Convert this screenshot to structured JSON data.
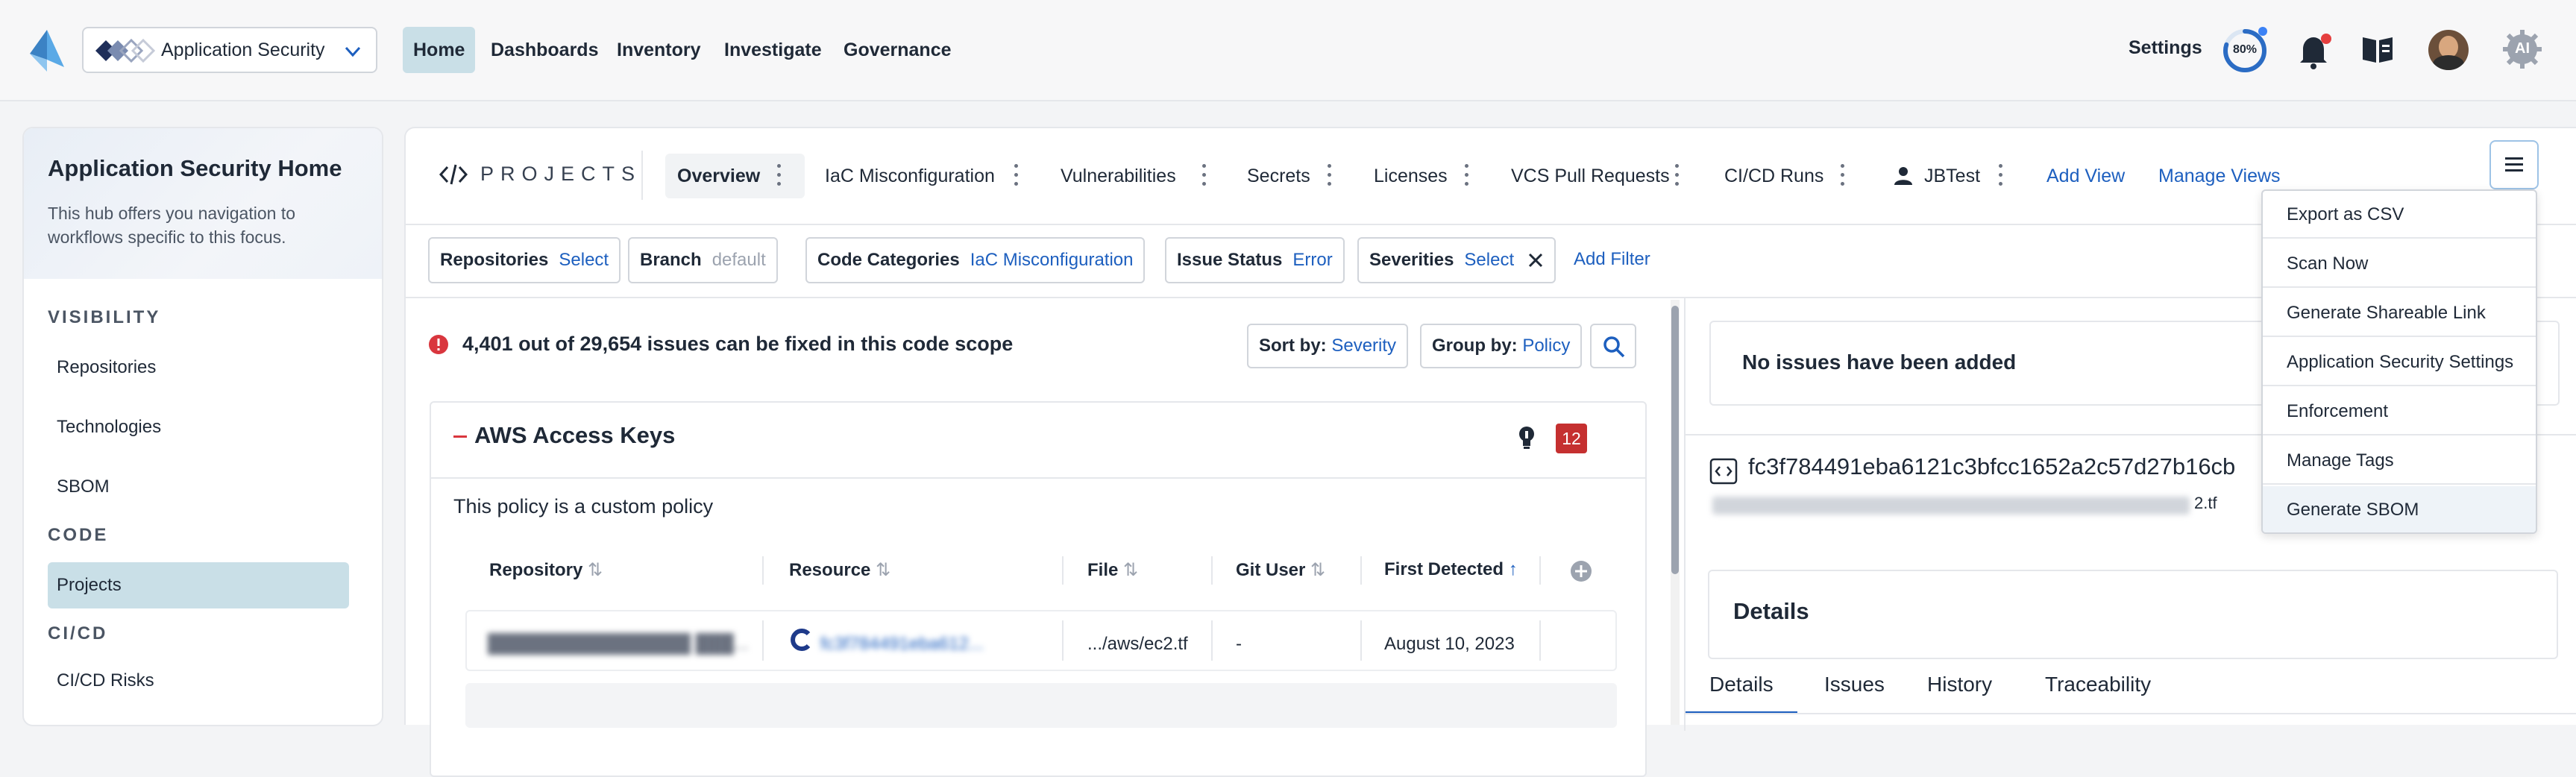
{
  "topbar": {
    "focus_label": "Application Security",
    "nav": [
      "Home",
      "Dashboards",
      "Inventory",
      "Investigate",
      "Governance"
    ],
    "settings_label": "Settings",
    "progress_label": "80%",
    "progress_value": 0.8,
    "ai_label": "AI",
    "accent_color": "#c9dfe7"
  },
  "sidebar": {
    "title": "Application Security Home",
    "subtitle": "This hub offers you navigation to workflows specific to this focus.",
    "sections": {
      "visibility": "VISIBILITY",
      "code": "CODE",
      "cicd": "CI/CD"
    },
    "items": {
      "repositories": "Repositories",
      "technologies": "Technologies",
      "sbom": "SBOM",
      "projects": "Projects",
      "cicd_risks": "CI/CD Risks"
    }
  },
  "main": {
    "projects_label": "PROJECTS",
    "tabs": [
      "Overview",
      "IaC Misconfiguration",
      "Vulnerabilities",
      "Secrets",
      "Licenses",
      "VCS Pull Requests",
      "CI/CD Runs",
      "JBTest"
    ],
    "add_view": "Add View",
    "manage_views": "Manage Views"
  },
  "filters": {
    "repositories": {
      "label": "Repositories",
      "value": "Select"
    },
    "branch": {
      "label": "Branch",
      "value": "default"
    },
    "code_categories": {
      "label": "Code Categories",
      "value": "IaC Misconfiguration"
    },
    "issue_status": {
      "label": "Issue Status",
      "value": "Error"
    },
    "severities": {
      "label": "Severities",
      "value": "Select"
    },
    "add_filter": "Add Filter"
  },
  "issues": {
    "summary": "4,401 out of 29,654 issues can be fixed in this code scope",
    "sort_by_label": "Sort by:",
    "sort_by_value": "Severity",
    "group_by_label": "Group by:",
    "group_by_value": "Policy"
  },
  "policy": {
    "name": "AWS Access Keys",
    "count": "12",
    "description": "This policy is a custom policy",
    "columns": {
      "repository": "Repository",
      "resource": "Resource",
      "file": "File",
      "git_user": "Git User",
      "first_detected": "First Detected"
    },
    "rows": [
      {
        "repository": "████████████████ ███...",
        "resource": "fc3f784491eba612...",
        "file": ".../aws/ec2.tf",
        "git_user": "-",
        "first_detected": "August 10, 2023"
      }
    ]
  },
  "details": {
    "no_issues": "No issues have been added",
    "hash": "fc3f784491eba6121c3bfcc1652a2c57d27b16cb",
    "path_suffix": "2.tf",
    "tabs": [
      "Details",
      "Issues",
      "History",
      "Traceability"
    ],
    "section_title": "Details"
  },
  "menu": {
    "items": [
      "Export as CSV",
      "Scan Now",
      "Generate Shareable Link",
      "Application Security Settings",
      "Enforcement",
      "Manage Tags",
      "Generate SBOM"
    ]
  }
}
